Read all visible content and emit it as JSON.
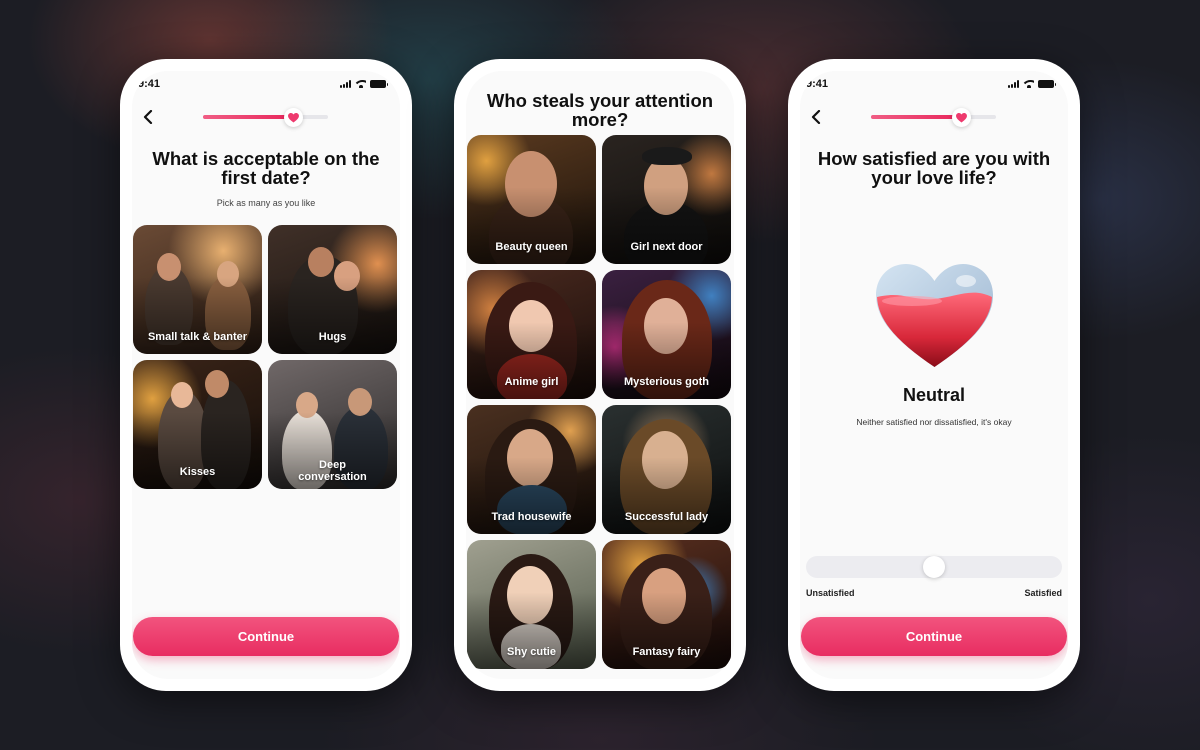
{
  "screen1": {
    "status": {
      "time": "9:41"
    },
    "progress": 0.72,
    "question": "What is acceptable on the first date?",
    "hint": "Pick as many as you like",
    "options": [
      {
        "label": "Small talk & banter"
      },
      {
        "label": "Hugs"
      },
      {
        "label": "Kisses"
      },
      {
        "label": "Deep conversation"
      }
    ],
    "continue_label": "Continue"
  },
  "screen2": {
    "question": "Who steals your attention more?",
    "options": [
      {
        "label": "Beauty queen"
      },
      {
        "label": "Girl next door"
      },
      {
        "label": "Anime girl"
      },
      {
        "label": "Mysterious goth"
      },
      {
        "label": "Trad housewife"
      },
      {
        "label": "Successful lady"
      },
      {
        "label": "Shy cutie"
      },
      {
        "label": "Fantasy fairy"
      }
    ]
  },
  "screen3": {
    "status": {
      "time": "9:41"
    },
    "progress": 0.72,
    "question": "How satisfied are you with your love life?",
    "state_title": "Neutral",
    "state_description": "Neither satisfied nor dissatisfied, it's okay",
    "slider": {
      "value": 0.5,
      "min_label": "Unsatisfied",
      "max_label": "Satisfied"
    },
    "continue_label": "Continue"
  },
  "colors": {
    "accent": "#e8265b",
    "accent_light": "#f05d84"
  }
}
